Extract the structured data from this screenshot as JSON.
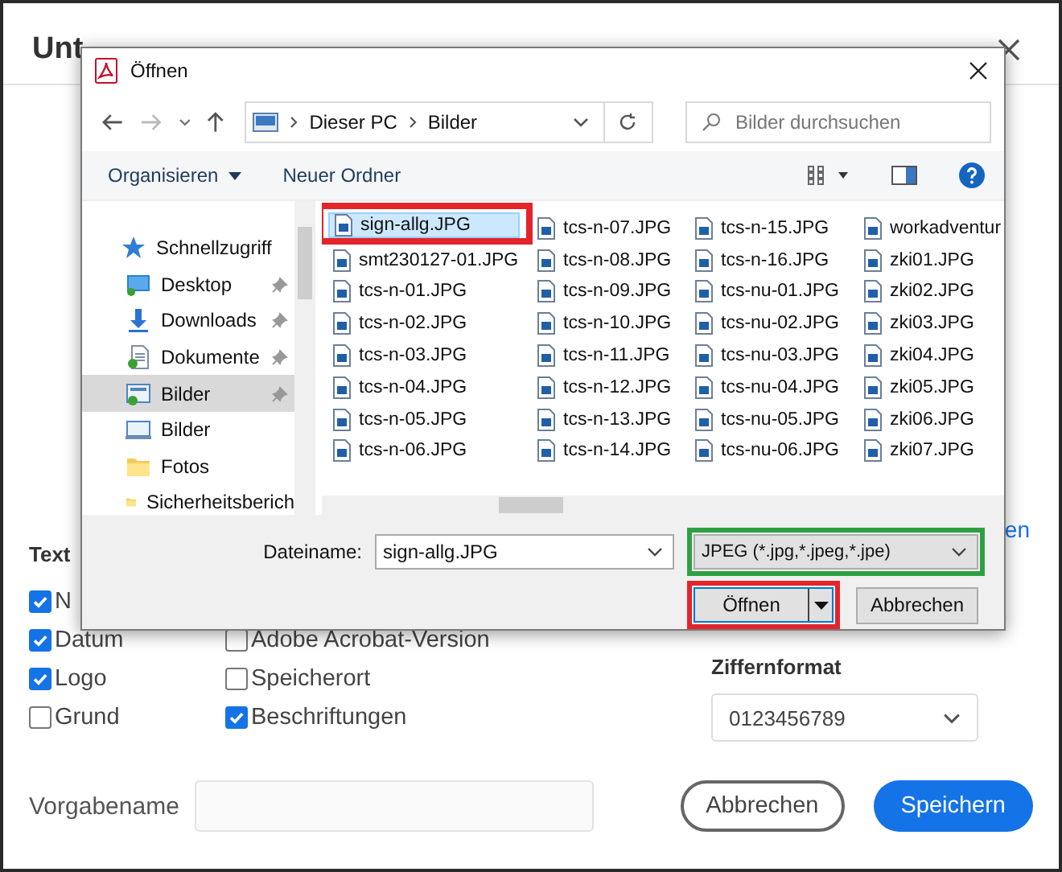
{
  "background": {
    "title": "Unt",
    "link": "en",
    "section_title": "Text",
    "options_left": [
      {
        "label": "N",
        "checked": true
      },
      {
        "label": "Datum",
        "checked": true
      },
      {
        "label": "Logo",
        "checked": true
      },
      {
        "label": "Grund",
        "checked": false
      }
    ],
    "options_right": [
      {
        "label": "Adobe Acrobat-Version",
        "checked": false
      },
      {
        "label": "Speicherort",
        "checked": false
      },
      {
        "label": "Beschriftungen",
        "checked": true
      }
    ],
    "digit_format": {
      "label": "Ziffernformat",
      "value": "0123456789"
    },
    "preset": {
      "label": "Vorgabename"
    },
    "buttons": [
      {
        "label": "Abbrechen",
        "kind": "secondary"
      },
      {
        "label": "Speichern",
        "kind": "primary"
      }
    ]
  },
  "dialog": {
    "title": "Öffnen",
    "breadcrumb": [
      "Dieser PC",
      "Bilder"
    ],
    "search": {
      "placeholder": "Bilder durchsuchen"
    },
    "toolbar": {
      "organize": "Organisieren",
      "new_folder": "Neuer Ordner"
    },
    "nav": [
      {
        "label": "Schnellzugriff",
        "kind": "quick",
        "children": [
          {
            "label": "Desktop",
            "kind": "desktop",
            "pinned": true,
            "selected": false
          },
          {
            "label": "Downloads",
            "kind": "downloads",
            "pinned": true,
            "selected": false
          },
          {
            "label": "Dokumente",
            "kind": "documents",
            "pinned": true,
            "selected": false
          },
          {
            "label": "Bilder",
            "kind": "pictures",
            "pinned": true,
            "selected": true
          },
          {
            "label": "Bilder",
            "kind": "library",
            "pinned": false,
            "selected": false
          },
          {
            "label": "Fotos",
            "kind": "folder",
            "pinned": false,
            "selected": false
          },
          {
            "label": "Sicherheitsberich",
            "kind": "folder",
            "pinned": false,
            "selected": false
          }
        ]
      }
    ],
    "files": [
      {
        "name": "sign-allg.JPG",
        "selected": true,
        "highlighted": true
      },
      {
        "name": "smt230127-01.JPG",
        "selected": false
      },
      {
        "name": "tcs-n-01.JPG",
        "selected": false
      },
      {
        "name": "tcs-n-02.JPG",
        "selected": false
      },
      {
        "name": "tcs-n-03.JPG",
        "selected": false
      },
      {
        "name": "tcs-n-04.JPG",
        "selected": false
      },
      {
        "name": "tcs-n-05.JPG",
        "selected": false
      },
      {
        "name": "tcs-n-06.JPG",
        "selected": false
      },
      {
        "name": "tcs-n-07.JPG",
        "selected": false
      },
      {
        "name": "tcs-n-08.JPG",
        "selected": false
      },
      {
        "name": "tcs-n-09.JPG",
        "selected": false
      },
      {
        "name": "tcs-n-10.JPG",
        "selected": false
      },
      {
        "name": "tcs-n-11.JPG",
        "selected": false
      },
      {
        "name": "tcs-n-12.JPG",
        "selected": false
      },
      {
        "name": "tcs-n-13.JPG",
        "selected": false
      },
      {
        "name": "tcs-n-14.JPG",
        "selected": false
      },
      {
        "name": "tcs-n-15.JPG",
        "selected": false
      },
      {
        "name": "tcs-n-16.JPG",
        "selected": false
      },
      {
        "name": "tcs-nu-01.JPG",
        "selected": false
      },
      {
        "name": "tcs-nu-02.JPG",
        "selected": false
      },
      {
        "name": "tcs-nu-03.JPG",
        "selected": false
      },
      {
        "name": "tcs-nu-04.JPG",
        "selected": false
      },
      {
        "name": "tcs-nu-05.JPG",
        "selected": false
      },
      {
        "name": "tcs-nu-06.JPG",
        "selected": false
      },
      {
        "name": "workadventur",
        "selected": false
      },
      {
        "name": "zki01.JPG",
        "selected": false
      },
      {
        "name": "zki02.JPG",
        "selected": false
      },
      {
        "name": "zki03.JPG",
        "selected": false
      },
      {
        "name": "zki04.JPG",
        "selected": false
      },
      {
        "name": "zki05.JPG",
        "selected": false
      },
      {
        "name": "zki06.JPG",
        "selected": false
      },
      {
        "name": "zki07.JPG",
        "selected": false
      }
    ],
    "filename": {
      "label": "Dateiname:",
      "value": "sign-allg.JPG"
    },
    "filter": {
      "value": "JPEG (*.jpg,*.jpeg,*.jpe)",
      "highlighted": true
    },
    "open_button": {
      "label": "Öffnen",
      "highlighted": true
    },
    "cancel_button": {
      "label": "Abbrechen"
    }
  }
}
